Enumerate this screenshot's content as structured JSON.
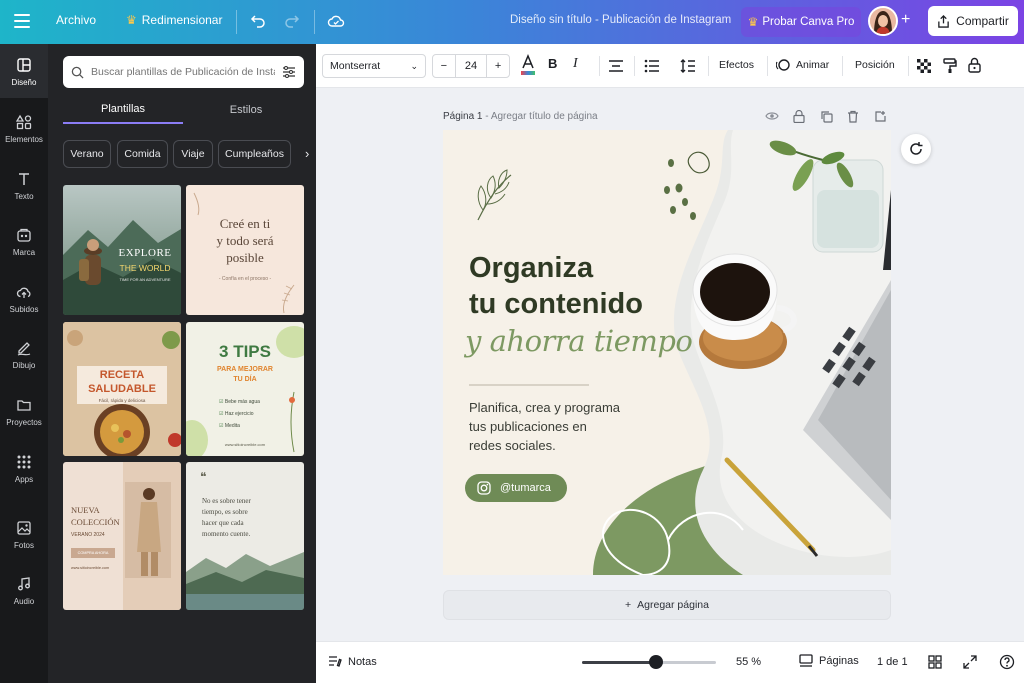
{
  "topbar": {
    "file_label": "Archivo",
    "resize_label": "Redimensionar",
    "doc_title": "Diseño sin título - Publicación de Instagram",
    "pro_label": "Probar Canva Pro",
    "share_label": "Compartir"
  },
  "rail": [
    {
      "label": "Diseño",
      "icon": "layout-icon"
    },
    {
      "label": "Elementos",
      "icon": "shapes-icon"
    },
    {
      "label": "Texto",
      "icon": "text-icon"
    },
    {
      "label": "Marca",
      "icon": "brand-icon"
    },
    {
      "label": "Subidos",
      "icon": "upload-cloud-icon"
    },
    {
      "label": "Dibujo",
      "icon": "pen-icon"
    },
    {
      "label": "Proyectos",
      "icon": "folder-icon"
    },
    {
      "label": "Apps",
      "icon": "apps-grid-icon"
    },
    {
      "label": "Fotos",
      "icon": "image-icon"
    },
    {
      "label": "Audio",
      "icon": "music-note-icon"
    }
  ],
  "panel": {
    "search_placeholder": "Buscar plantillas de Publicación de Instagram",
    "tabs": [
      "Plantillas",
      "Estilos"
    ],
    "chips": [
      "Verano",
      "Comida",
      "Viaje",
      "Cumpleaños"
    ],
    "templates": {
      "t1": {
        "title": "EXPLORE",
        "title2": "THE WORLD",
        "sub": "TIME FOR AN ADVENTURE"
      },
      "t2": {
        "line1": "Creé en ti",
        "line2": "y todo será",
        "line3": "posible",
        "sub": "- Confía en el proceso -"
      },
      "t3": {
        "line1": "RECETA",
        "line2": "SALUDABLE",
        "sub": "Fácil, rápida y deliciosa"
      },
      "t4": {
        "big": "3 TIPS",
        "line1": "PARA MEJORAR",
        "line2": "TU DÍA",
        "items": [
          "Bebe más agua",
          "Haz ejercicio",
          "Medita"
        ],
        "url": "www.sitioincreible.com"
      },
      "t5": {
        "line1": "NUEVA",
        "line2": "COLECCIÓN",
        "line3": "VERANO 2024",
        "btn": "COMPRA AHORA",
        "url": "www.sitioincreible.com"
      },
      "t6": {
        "quote_mark": "❝",
        "line1": "No es sobre tener",
        "line2": "tiempo, es sobre",
        "line3": "hacer que cada",
        "line4": "momento cuente."
      }
    }
  },
  "toolbar": {
    "font": "Montserrat",
    "size": "24",
    "minus": "−",
    "plus": "+",
    "effects": "Efectos",
    "animate": "Animar",
    "position": "Posición"
  },
  "page": {
    "label": "Página 1",
    "add_title": "- Agregar título de página",
    "add_page": "Agregar página"
  },
  "design": {
    "headline1": "Organiza",
    "headline2": "tu contenido",
    "script": "y ahorra tiempo",
    "body1": "Planifica, crea y programa",
    "body2": "tus publicaciones en",
    "body3": "redes sociales.",
    "handle": "@tumarca",
    "colors": {
      "green": "#7d9962",
      "cream": "#f6f1e8",
      "dark": "#2f3a24"
    }
  },
  "bottombar": {
    "notes": "Notas",
    "zoom_value": 0.55,
    "zoom": "55 %",
    "pages": "Páginas",
    "page_count": "1 de 1"
  }
}
